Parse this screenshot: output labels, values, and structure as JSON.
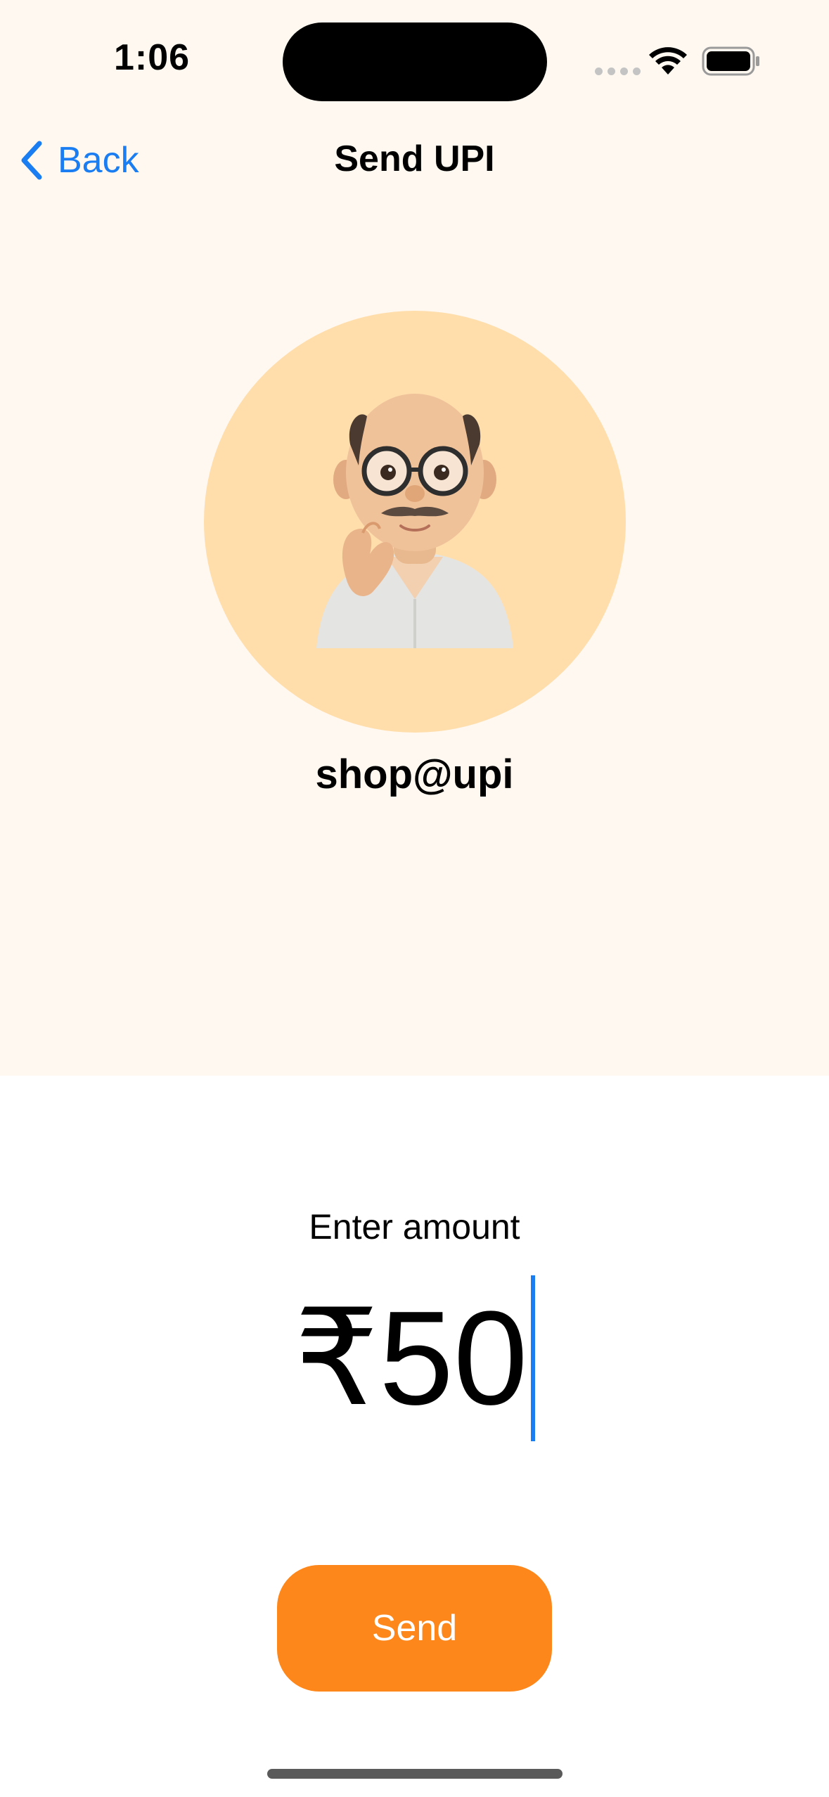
{
  "status_bar": {
    "time": "1:06"
  },
  "nav": {
    "back_label": "Back",
    "title": "Send UPI"
  },
  "payee": {
    "upi_id": "shop@upi",
    "avatar_icon": "memoji-avatar"
  },
  "amount": {
    "label": "Enter amount",
    "currency_symbol": "₹",
    "value": "50"
  },
  "actions": {
    "send_label": "Send"
  },
  "colors": {
    "accent": "#1a7df2",
    "send_button": "#fd871a",
    "avatar_bg": "#ffdeac",
    "header_bg": "#fff8f0"
  }
}
